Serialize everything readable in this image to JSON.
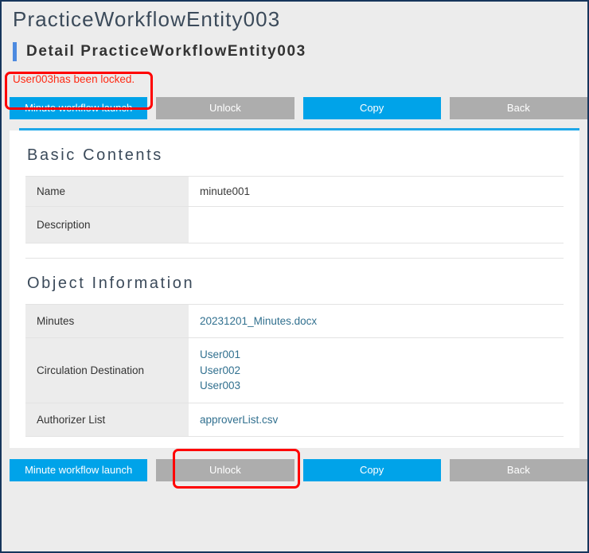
{
  "page": {
    "title": "PracticeWorkflowEntity003",
    "detail_heading": "Detail PracticeWorkflowEntity003"
  },
  "alert": {
    "message": "User003has been locked.",
    "color": "#ff2a14"
  },
  "toolbar": {
    "buttons": [
      {
        "label": "Minute workflow launch",
        "style": "primary"
      },
      {
        "label": "Unlock",
        "style": "disabled"
      },
      {
        "label": "Copy",
        "style": "primary"
      },
      {
        "label": "Back",
        "style": "disabled"
      }
    ]
  },
  "sections": {
    "basic": {
      "title": "Basic Contents",
      "rows": [
        {
          "label": "Name",
          "value": "minute001",
          "type": "text"
        },
        {
          "label": "Description",
          "value": "",
          "type": "text"
        }
      ]
    },
    "object": {
      "title": "Object Information",
      "rows": [
        {
          "label": "Minutes",
          "links": [
            "20231201_Minutes.docx"
          ]
        },
        {
          "label": "Circulation Destination",
          "links": [
            "User001",
            "User002",
            "User003"
          ]
        },
        {
          "label": "Authorizer List",
          "links": [
            "approverList.csv"
          ]
        }
      ]
    }
  },
  "theme": {
    "accent_blue": "#00a3e9",
    "disabled_grey": "#adadad",
    "link_blue": "#31708f",
    "heading_slate": "#3b4a5a",
    "window_border": "#16365c",
    "rule_cyan": "#1ea7e8",
    "annotation_red": "#ff0000"
  }
}
